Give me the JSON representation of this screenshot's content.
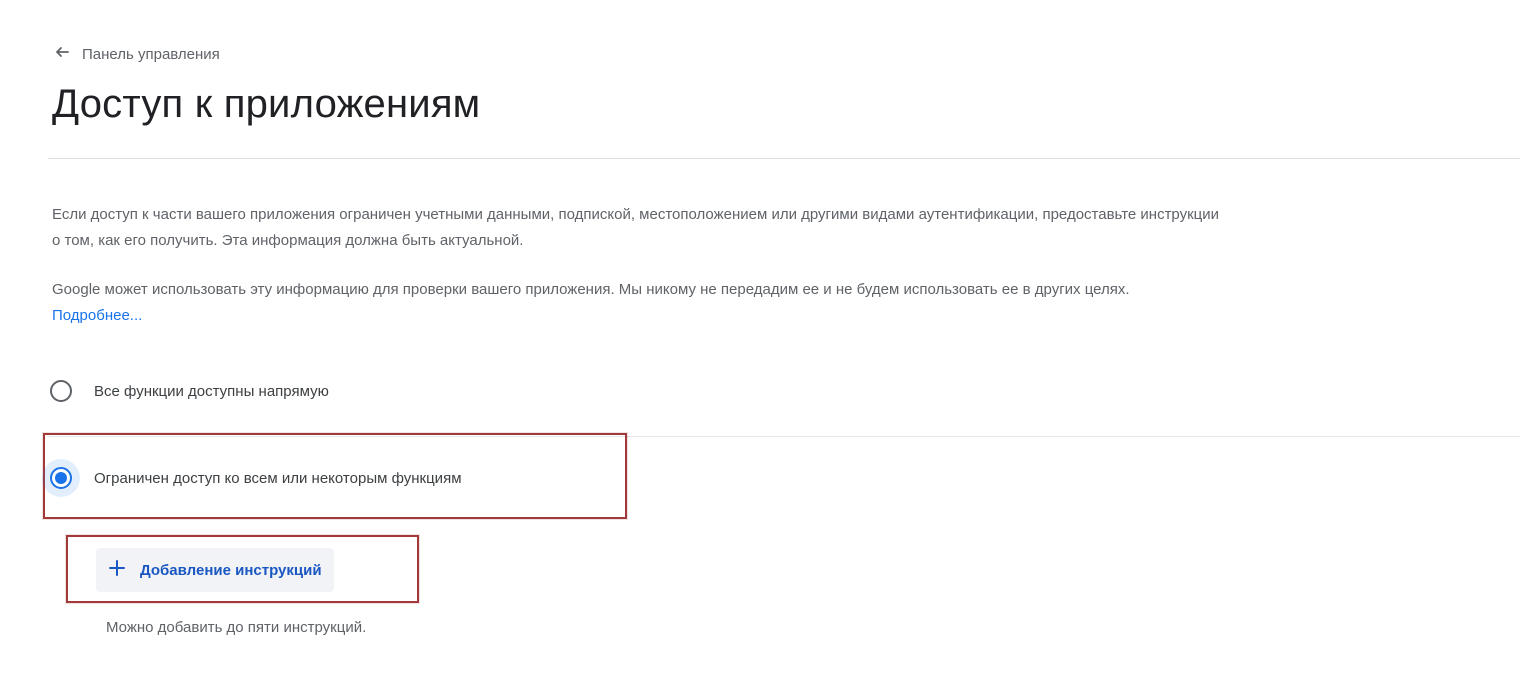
{
  "nav": {
    "back_icon": "arrow-left-icon",
    "back_label": "Панель управления"
  },
  "header": {
    "title": "Доступ к приложениям"
  },
  "description": {
    "paragraph1": "Если доступ к части вашего приложения ограничен учетными данными, подпиской, местоположением или другими видами аутентификации, предоставьте инструкции о том, как его получить. Эта информация должна быть актуальной.",
    "paragraph2": "Google может использовать эту информацию для проверки вашего приложения. Мы никому не передадим ее и не будем использовать ее в других целях.",
    "learn_more": "Подробнее..."
  },
  "options": [
    {
      "label": "Все функции доступны напрямую",
      "selected": false
    },
    {
      "label": "Ограничен доступ ко всем или некоторым функциям",
      "selected": true
    }
  ],
  "instructions": {
    "add_icon": "plus-icon",
    "add_label": "Добавление инструкций",
    "hint": "Можно добавить до пяти инструкций."
  },
  "colors": {
    "accent": "#1a73e8",
    "highlight_border": "#a33a3a",
    "title_text": "#202124",
    "body_text": "#5f6368"
  }
}
